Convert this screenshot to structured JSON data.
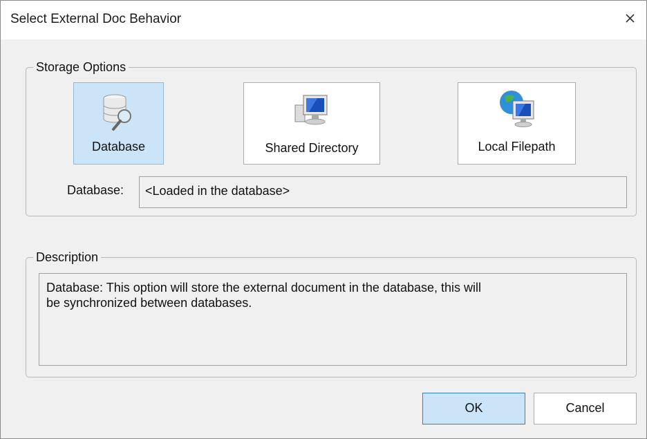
{
  "window": {
    "title": "Select External Doc Behavior",
    "close_icon": "close-icon"
  },
  "storage": {
    "legend": "Storage Options",
    "options": [
      {
        "label": "Database",
        "icon": "database-search-icon",
        "selected": true
      },
      {
        "label": "Shared Directory",
        "icon": "network-computer-icon",
        "selected": false
      },
      {
        "label": "Local Filepath",
        "icon": "globe-computer-icon",
        "selected": false
      }
    ],
    "field_label": "Database:",
    "field_value": "<Loaded in the database>"
  },
  "description": {
    "legend": "Description",
    "text_line1": "Database:  This option will store the external document in the database, this will",
    "text_line2": "be synchronized between databases."
  },
  "buttons": {
    "ok": "OK",
    "cancel": "Cancel"
  },
  "colors": {
    "dialog_bg": "#f0f0f0",
    "selected_bg": "#cce4f7",
    "accent_border": "#3c7fb1"
  }
}
